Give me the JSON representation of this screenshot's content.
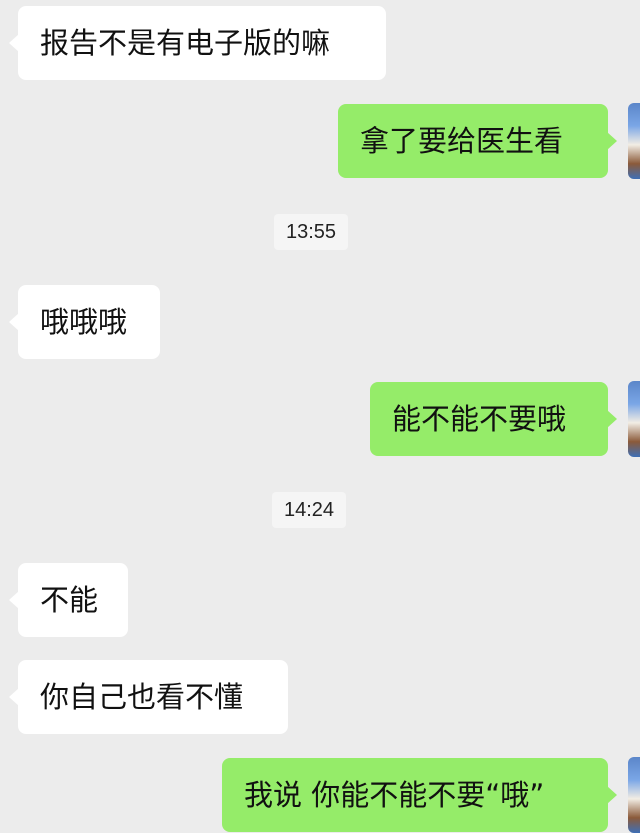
{
  "messages": [
    {
      "side": "in",
      "text": "报告不是有电子版的嘛"
    },
    {
      "side": "out",
      "text": "拿了要给医生看"
    },
    {
      "type": "time",
      "text": "13:55"
    },
    {
      "side": "in",
      "text": "哦哦哦"
    },
    {
      "side": "out",
      "text": "能不能不要哦"
    },
    {
      "type": "time",
      "text": "14:24"
    },
    {
      "side": "in",
      "text": "不能"
    },
    {
      "side": "in",
      "text": "你自己也看不懂"
    },
    {
      "side": "out",
      "text": "我说 你能不能不要“哦”"
    }
  ],
  "colors": {
    "background": "#ececec",
    "incoming_bubble": "#ffffff",
    "outgoing_bubble": "#95ec69",
    "timestamp_bg": "#f5f5f5"
  },
  "icons": {
    "avatar": "user-avatar-icon"
  }
}
